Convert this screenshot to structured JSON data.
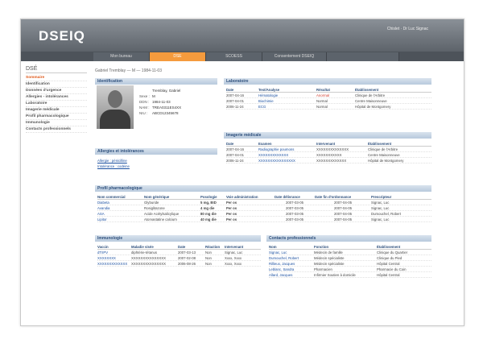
{
  "app": {
    "logo": "DSEIQ",
    "user": "Chislet · Dr Luc Signac"
  },
  "tabs": [
    "Mon bureau",
    "DSE",
    "SCOESS",
    "Consentement DSEIQ"
  ],
  "sidebar": {
    "title": "DSÉ",
    "items": [
      "Sommaire",
      "Identification",
      "Données d'urgence",
      "Allergies - intolérances",
      "Laboratoire",
      "Imagerie médicale",
      "Profil pharmacologique",
      "Immunologie",
      "Contacts professionnels"
    ]
  },
  "patient_line": "Gabriel Tremblay — M — 1984-11-03",
  "identification": {
    "title": "Identification",
    "lines": [
      {
        "k": "",
        "v": "Tremblay, Gabriel"
      },
      {
        "k": "Sexe :",
        "v": "M"
      },
      {
        "k": "DDN :",
        "v": "1984-11-03"
      },
      {
        "k": "NAM :",
        "v": "TREA0311ES4XX"
      },
      {
        "k": "NIU :",
        "v": "ABCD12345678"
      }
    ]
  },
  "allergies": {
    "title": "Allergies et intolérances",
    "items": [
      "Allergie : pénicilline",
      "Intolérance : codéine"
    ]
  },
  "labs": {
    "title": "Laboratoire",
    "headers": [
      "Date",
      "Test/Analyse",
      "Résultat",
      "Établissement"
    ],
    "rows": [
      [
        "2007-04-16",
        "Hématologie",
        "Anormal",
        "Clinique de l'Arbitre"
      ],
      [
        "2007-04-01",
        "Biochimie",
        "Normal",
        "Centre Maisonneuve"
      ],
      [
        "2006-11-24",
        "ECG",
        "Normal",
        "Hôpital de Montgomery"
      ]
    ]
  },
  "imaging": {
    "title": "Imagerie médicale",
    "headers": [
      "Date",
      "Examen",
      "Intervenant",
      "Établissement"
    ],
    "rows": [
      [
        "2007-04-16",
        "Radiographie poumons",
        "XXXXXXXXXXXXXX",
        "Clinique de l'Arbitre"
      ],
      [
        "2007-04-01",
        "XXXXXXXXXXXXX",
        "XXXXXXXXXXX",
        "Centre Maisonneuve"
      ],
      [
        "2006-11-24",
        "XXXXXXXXXXXXXXXX",
        "XXXXXXXXXXXXX",
        "Hôpital de Montgomery"
      ]
    ]
  },
  "pharma": {
    "title": "Profil pharmacologique",
    "headers": [
      "Nom commercial",
      "Nom générique",
      "Posologie",
      "Voie administration",
      "Date délivrance",
      "Date fin d'ordonnance",
      "Prescripteur"
    ],
    "rows": [
      [
        "Diabeta",
        "Glyburide",
        "5 mg, BID",
        "Per os",
        "2007-03-05",
        "2007-04-05",
        "Signac, Luc"
      ],
      [
        "Avandia",
        "Rosiglitazone",
        "4 mg die",
        "Per os",
        "2007-03-05",
        "2007-04-05",
        "Signac, Luc"
      ],
      [
        "ASA",
        "Acide Acétylsalicylique",
        "80 mg die",
        "Per os",
        "2007-03-05",
        "2007-04-05",
        "Dumouchel, Robert"
      ],
      [
        "Lipitor",
        "Atorvastatine calcium",
        "40 mg die",
        "Per os",
        "2007-03-05",
        "2007-04-05",
        "Signac, Luc"
      ]
    ]
  },
  "immuno": {
    "title": "Immunologie",
    "headers": [
      "Vaccin",
      "Maladie visée",
      "Date",
      "Réaction",
      "Intervenant"
    ],
    "rows": [
      [
        "dT/IPV",
        "diphtérie-tétanus",
        "2007-03-13",
        "Non",
        "Signac, Luc"
      ],
      [
        "XXXXXXXX",
        "XXXXXXXXXXXXXXX",
        "2007-02-08",
        "Non",
        "Xxxx, Xxxx"
      ],
      [
        "XXXXXXXXXXXXX",
        "XXXXXXXXXXXXXXX",
        "2006-08-26",
        "Non",
        "Xxxx, Xxxx"
      ]
    ]
  },
  "contacts": {
    "title": "Contacts professionnels",
    "headers": [
      "Nom",
      "Fonction",
      "Établissement"
    ],
    "rows": [
      [
        "Signac, Luc",
        "Médecin de famille",
        "Clinique du Quartier"
      ],
      [
        "Dumouchel, Robert",
        "Médecin spécialiste",
        "Clinique du Pied"
      ],
      [
        "Rillieux, Jacques",
        "Médecin spécialiste",
        "Hôpital Central"
      ],
      [
        "Leblanc, Sandra",
        "Pharmacien",
        "Pharmacie du Coin"
      ],
      [
        "Allard, Jacques",
        "Infirmier Soutien à domicile",
        "Hôpital Central"
      ]
    ]
  }
}
